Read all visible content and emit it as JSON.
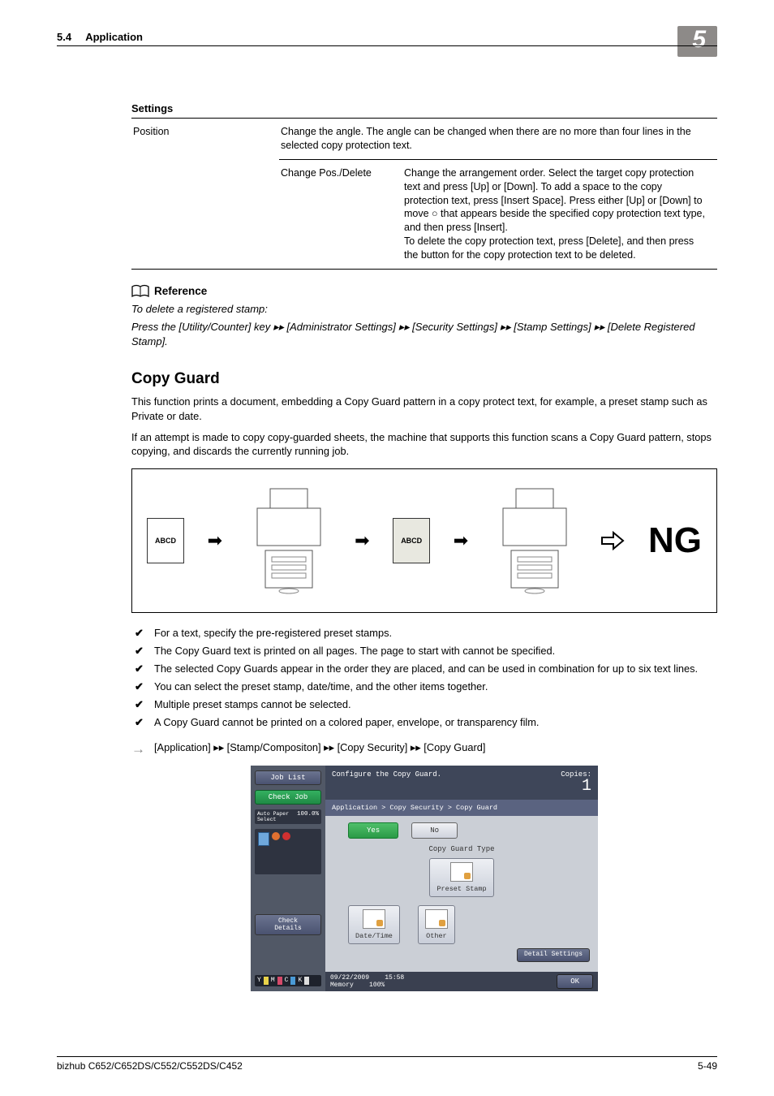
{
  "header": {
    "section_num": "5.4",
    "section_title": "Application",
    "chapter_num": "5"
  },
  "table": {
    "caption": "Settings",
    "r1c1": "Position",
    "r1c2": "Change the angle. The angle can be changed when there are no more than four lines in the selected copy protection text.",
    "r2c1": "Change Pos./Delete",
    "r2c2": "Change the arrangement order. Select the target copy protection text and press [Up] or [Down]. To add a space to the copy protection text, press [Insert Space]. Press either [Up] or [Down] to move ○ that appears beside the specified copy protection text type, and then press [Insert].\nTo delete the copy protection text, press [Delete], and then press the button for the copy protection text to be deleted."
  },
  "reference": {
    "heading": "Reference",
    "line1": "To delete a registered stamp:",
    "line2": "Press the [Utility/Counter] key ▸▸ [Administrator Settings] ▸▸ [Security Settings] ▸▸ [Stamp Settings] ▸▸ [Delete Registered Stamp]."
  },
  "copy_guard": {
    "title": "Copy Guard",
    "p1": "This function prints a document, embedding a Copy Guard pattern in a copy protect text, for example, a preset stamp such as Private or date.",
    "p2": "If an attempt is made to copy copy-guarded sheets, the machine that supports this function scans a Copy Guard pattern, stops copying, and discards the currently running job."
  },
  "diagram": {
    "doc_text": "ABCD",
    "result": "NG"
  },
  "bullets": [
    "For a text, specify the pre-registered preset stamps.",
    "The Copy Guard text is printed on all pages. The page to start with cannot be specified.",
    "The selected Copy Guards appear in the order they are placed, and can be used in combination for up to six text lines.",
    "You can select the preset stamp, date/time, and the other items together.",
    "Multiple preset stamps cannot be selected.",
    "A Copy Guard cannot be printed on a colored paper, envelope, or transparency film."
  ],
  "nav": "[Application] ▸▸ [Stamp/Compositon] ▸▸ [Copy Security] ▸▸ [Copy Guard]",
  "screenshot": {
    "job_list": "Job List",
    "check_job": "Check Job",
    "paper_auto": "Auto Paper Select",
    "paper_pct": "100.0%",
    "check_details": "Check Details",
    "title": "Configure the Copy Guard.",
    "copies_label": "Copies:",
    "copies_value": "1",
    "breadcrumb": "Application > Copy Security > Copy Guard",
    "yes": "Yes",
    "no": "No",
    "type_heading": "Copy Guard Type",
    "preset_stamp": "Preset Stamp",
    "date_time": "Date/Time",
    "other": "Other",
    "detail": "Detail Settings",
    "date": "09/22/2009",
    "time": "15:58",
    "memory": "Memory",
    "mem_pct": "100%",
    "ok": "OK",
    "toners": [
      "Y",
      "M",
      "C",
      "K"
    ]
  },
  "footer": {
    "left": "bizhub C652/C652DS/C552/C552DS/C452",
    "right": "5-49"
  }
}
